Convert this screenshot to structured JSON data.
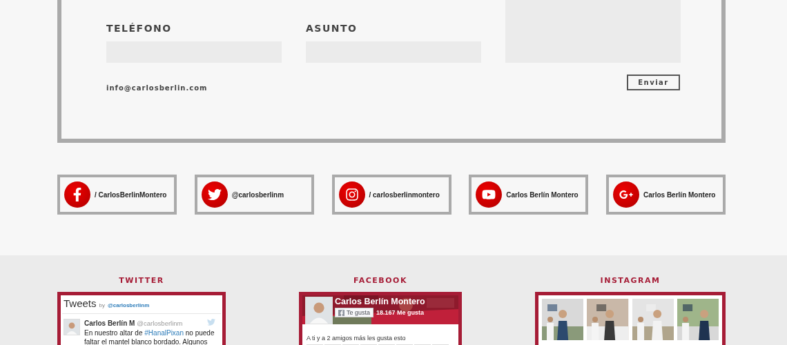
{
  "contact": {
    "fields": [
      {
        "label": "TELÉFONO"
      },
      {
        "label": "ASUNTO"
      }
    ],
    "email": "info@carlosberlin.com",
    "submit": "Enviar"
  },
  "social": [
    {
      "kind": "facebook",
      "label": "/ CarlosBerlinMontero"
    },
    {
      "kind": "twitter",
      "label": "@carlosberlinm"
    },
    {
      "kind": "instagram",
      "label": "/ carlosberlinmontero"
    },
    {
      "kind": "youtube",
      "label": "Carlos Berlín Montero"
    },
    {
      "kind": "googleplus",
      "label": "Carlos Berlín Montero"
    }
  ],
  "twitter": {
    "heading": "TWITTER",
    "title": "Tweets",
    "by": "by",
    "handle": "@carlosberlinm",
    "tweet": {
      "name": "Carlos Berlín M",
      "handle": "@carlosberlinm",
      "text_before": "En nuestro altar de",
      "hashtag": "#HanalPixan",
      "text_after": "no puede faltar el mantel blanco bordado. Algunos"
    }
  },
  "facebook": {
    "heading": "FACEBOOK",
    "page_name": "Carlos Berlín Montero",
    "like_button": "Te gusta",
    "likes": "18.167 Me gusta",
    "friends": "A ti y a 2 amigos más les gusta esto"
  },
  "instagram": {
    "heading": "INSTAGRAM"
  }
}
